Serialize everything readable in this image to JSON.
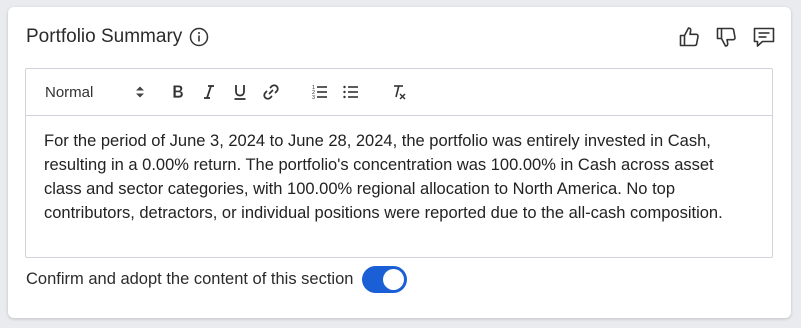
{
  "section": {
    "title": "Portfolio Summary",
    "info_icon": "info-circle-icon",
    "actions": [
      "thumbs-up-icon",
      "thumbs-down-icon",
      "comment-icon"
    ]
  },
  "toolbar": {
    "format_value": "Normal",
    "buttons": [
      "bold",
      "italic",
      "underline",
      "link",
      "ordered-list",
      "bullet-list",
      "clear-formatting"
    ]
  },
  "editor": {
    "content": "For the period of June 3, 2024 to June 28, 2024, the portfolio was entirely invested in Cash, resulting in a 0.00% return. The portfolio's concentration was 100.00% in Cash across asset class and sector categories, with 100.00% regional allocation to North America. No top contributors, detractors, or individual positions were reported due to the all-cash composition."
  },
  "confirm": {
    "label": "Confirm and adopt the content of this section",
    "toggle_on": true
  },
  "colors": {
    "accent": "#1a5fd6",
    "background": "#e9ebef",
    "border": "#d0d4da"
  }
}
